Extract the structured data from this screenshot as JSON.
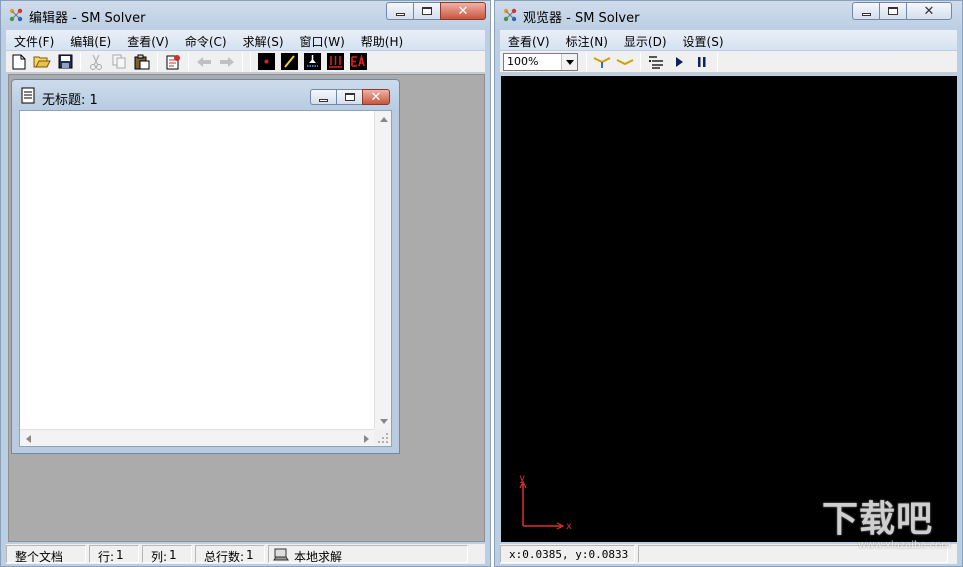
{
  "editor": {
    "title": "编辑器 - SM Solver",
    "menu": [
      "文件(F)",
      "编辑(E)",
      "查看(V)",
      "命令(C)",
      "求解(S)",
      "窗口(W)",
      "帮助(H)"
    ],
    "document": {
      "title": "无标题: 1"
    },
    "status": {
      "scope": "整个文档",
      "row_label": "行:",
      "row_value": "1",
      "col_label": "列:",
      "col_value": "1",
      "total_label": "总行数:",
      "total_value": "1",
      "mode": "本地求解"
    }
  },
  "viewer": {
    "title": "观览器 - SM Solver",
    "menu": [
      "查看(V)",
      "标注(N)",
      "显示(D)",
      "设置(S)"
    ],
    "zoom": "100%",
    "axis_y": "y",
    "axis_x": "x",
    "coordinates": "x:0.0385, y:0.0833"
  },
  "icons": {
    "toolbar": [
      "new-file-icon",
      "open-folder-icon",
      "save-icon",
      "cut-icon",
      "copy-icon",
      "paste-icon",
      "solve-icon",
      "back-arrow-icon",
      "forward-arrow-icon",
      "node-icon",
      "rod-icon",
      "support-icon",
      "load-icon",
      "ea-icon"
    ],
    "viewer_toolbar": [
      "expand-icon",
      "collapse-icon",
      "settings-list-icon",
      "play-icon",
      "pause-icon"
    ]
  },
  "watermark": {
    "text": "下载吧",
    "url_text": "www.xiazaiba.com"
  },
  "colors": {
    "canvas_background": "#000000",
    "axis": "#e03030",
    "mdi_background": "#ababab"
  }
}
